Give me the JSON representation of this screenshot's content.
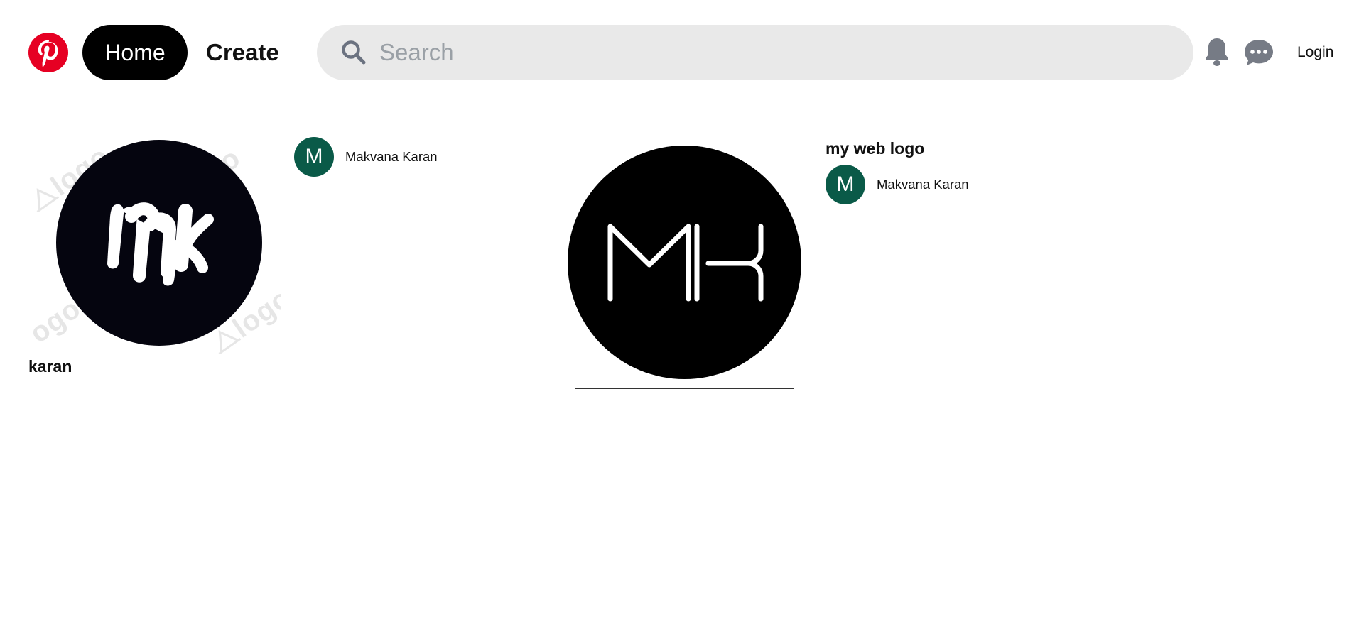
{
  "header": {
    "logo_icon": "pinterest-logo",
    "home_label": "Home",
    "create_label": "Create",
    "search": {
      "placeholder": "Search",
      "value": ""
    },
    "notifications_icon": "bell-icon",
    "messages_icon": "chat-icon",
    "login_label": "Login"
  },
  "colors": {
    "brand": "#e60023",
    "home_bg": "#000000",
    "search_bg": "#e9e9e9",
    "icon_gray": "#767b85",
    "avatar_bg": "#0a5a48"
  },
  "pins": [
    {
      "title": "karan",
      "image_text": "mk",
      "author": {
        "initial": "M",
        "name": "Makvana Karan"
      }
    },
    {
      "title": "my web logo",
      "image_text": "MK",
      "author": {
        "initial": "M",
        "name": "Makvana Karan"
      }
    }
  ]
}
